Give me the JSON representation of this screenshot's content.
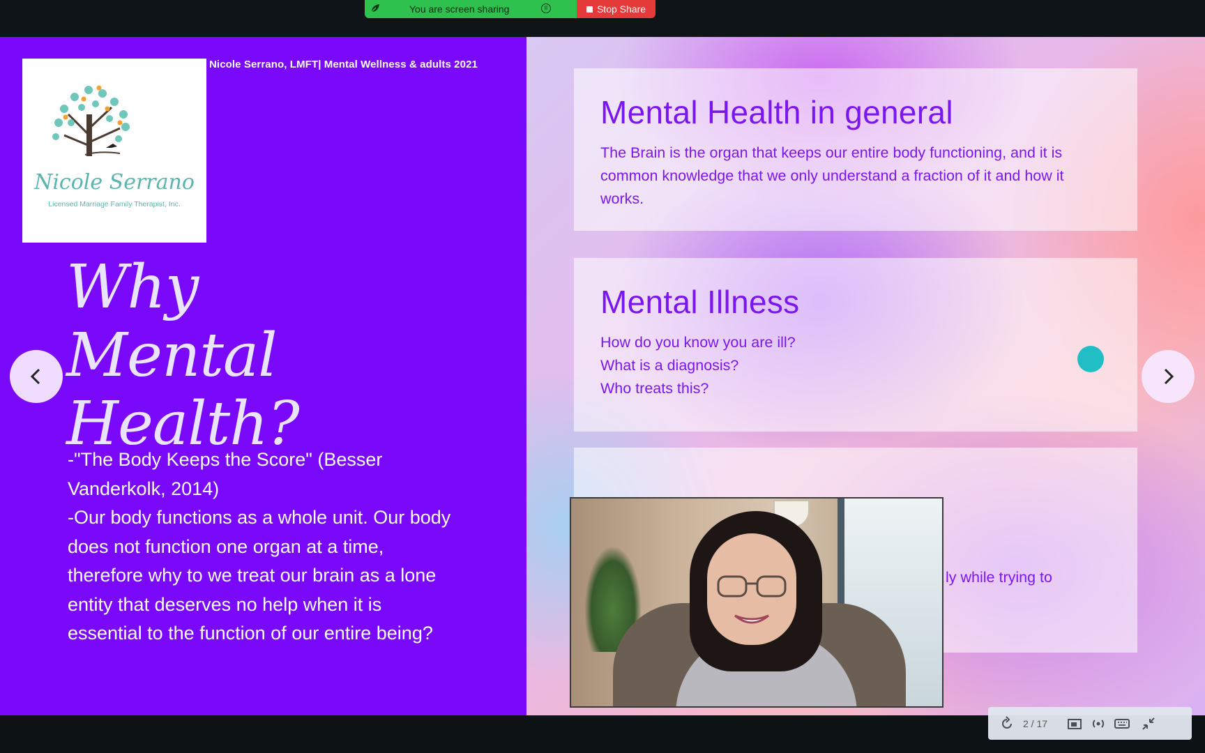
{
  "share_bar": {
    "sharing_text": "You are screen sharing",
    "stop_label": "Stop Share"
  },
  "slide": {
    "header": "Nicole Serrano, LMFT| Mental Wellness & adults 2021",
    "logo": {
      "name": "Nicole Serrano",
      "subtitle": "Licensed Marriage Family Therapist, Inc."
    },
    "title_line1": "Why Mental",
    "title_line2": "Health?",
    "body_para1": "-\"The Body Keeps the Score\" (Besser Vanderkolk, 2014)",
    "body_para2": "-Our body functions as a whole unit. Our body does not function one organ at a time, therefore why to we treat our brain as a lone entity  that deserves  no help when it is essential to the function of our entire being?",
    "cards": [
      {
        "heading": "Mental Health in general",
        "text": "The Brain is the organ that keeps our entire body functioning, and it is common knowledge that we only understand a fraction of it and how it works."
      },
      {
        "heading": "Mental Illness",
        "lines": [
          "How do you know you are ill?",
          "What is a diagnosis?",
          "Who treats this?"
        ]
      },
      {
        "partial_text": "ly while trying to"
      }
    ]
  },
  "controls": {
    "slide_counter": "2 / 17"
  },
  "colors": {
    "left_panel": "#7a08fb",
    "card_text": "#7a17f0",
    "share_green": "#2fc14e",
    "stop_red": "#e53a3a",
    "cursor_dot": "#22bec6"
  },
  "icons": {
    "prev": "chevron-left-icon",
    "next": "chevron-right-icon",
    "reload": "rotate-icon",
    "present": "presenter-icon",
    "broadcast": "broadcast-icon",
    "keyboard": "keyboard-icon",
    "collapse": "collapse-icon"
  }
}
